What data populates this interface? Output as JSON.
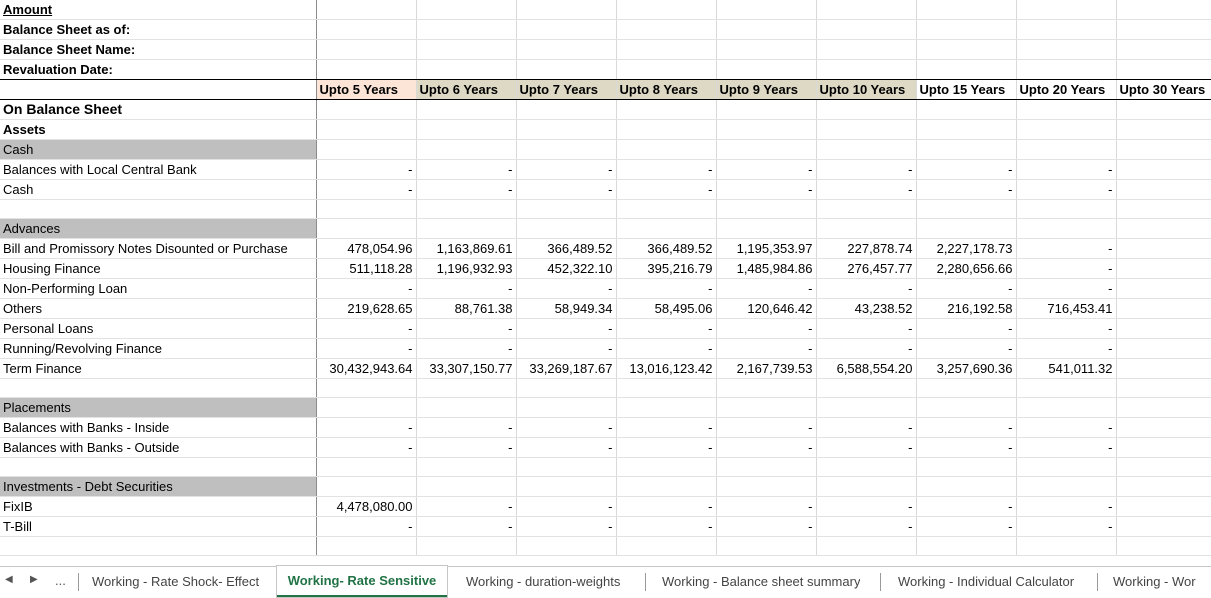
{
  "meta": {
    "amount": "Amount",
    "as_of": "Balance Sheet as of:",
    "name": "Balance Sheet Name:",
    "reval": "Revaluation Date:"
  },
  "columns": [
    "Upto 5 Years",
    "Upto 6 Years",
    "Upto 7 Years",
    "Upto 8 Years",
    "Upto 9 Years",
    "Upto 10 Years",
    "Upto 15 Years",
    "Upto 20 Years",
    "Upto 30 Years"
  ],
  "rows": [
    {
      "label": "On Balance Sheet",
      "style": "title",
      "values": []
    },
    {
      "label": "Assets",
      "style": "bold",
      "values": []
    },
    {
      "label": "Cash",
      "style": "section",
      "values": []
    },
    {
      "label": "Balances with Local Central Bank",
      "style": "",
      "values": [
        "-",
        "-",
        "-",
        "-",
        "-",
        "-",
        "-",
        "-",
        ""
      ]
    },
    {
      "label": "Cash",
      "style": "",
      "values": [
        "-",
        "-",
        "-",
        "-",
        "-",
        "-",
        "-",
        "-",
        ""
      ]
    },
    {
      "label": "",
      "style": "",
      "values": []
    },
    {
      "label": "Advances",
      "style": "section",
      "values": []
    },
    {
      "label": "Bill and Promissory Notes Disounted or Purchase",
      "style": "",
      "values": [
        "478,054.96",
        "1,163,869.61",
        "366,489.52",
        "366,489.52",
        "1,195,353.97",
        "227,878.74",
        "2,227,178.73",
        "-",
        ""
      ]
    },
    {
      "label": "Housing Finance",
      "style": "",
      "values": [
        "511,118.28",
        "1,196,932.93",
        "452,322.10",
        "395,216.79",
        "1,485,984.86",
        "276,457.77",
        "2,280,656.66",
        "-",
        ""
      ]
    },
    {
      "label": "Non-Performing Loan",
      "style": "",
      "values": [
        "-",
        "-",
        "-",
        "-",
        "-",
        "-",
        "-",
        "-",
        ""
      ]
    },
    {
      "label": "Others",
      "style": "",
      "values": [
        "219,628.65",
        "88,761.38",
        "58,949.34",
        "58,495.06",
        "120,646.42",
        "43,238.52",
        "216,192.58",
        "716,453.41",
        ""
      ]
    },
    {
      "label": "Personal Loans",
      "style": "",
      "values": [
        "-",
        "-",
        "-",
        "-",
        "-",
        "-",
        "-",
        "-",
        ""
      ]
    },
    {
      "label": "Running/Revolving Finance",
      "style": "",
      "values": [
        "-",
        "-",
        "-",
        "-",
        "-",
        "-",
        "-",
        "-",
        ""
      ]
    },
    {
      "label": "Term Finance",
      "style": "",
      "values": [
        "30,432,943.64",
        "33,307,150.77",
        "33,269,187.67",
        "13,016,123.42",
        "2,167,739.53",
        "6,588,554.20",
        "3,257,690.36",
        "541,011.32",
        ""
      ]
    },
    {
      "label": "",
      "style": "",
      "values": []
    },
    {
      "label": "Placements",
      "style": "section",
      "values": []
    },
    {
      "label": "Balances with Banks - Inside",
      "style": "",
      "values": [
        "-",
        "-",
        "-",
        "-",
        "-",
        "-",
        "-",
        "-",
        ""
      ]
    },
    {
      "label": "Balances with Banks - Outside",
      "style": "",
      "values": [
        "-",
        "-",
        "-",
        "-",
        "-",
        "-",
        "-",
        "-",
        ""
      ]
    },
    {
      "label": "",
      "style": "",
      "values": []
    },
    {
      "label": "Investments - Debt Securities",
      "style": "section",
      "values": []
    },
    {
      "label": "FixIB",
      "style": "",
      "values": [
        "4,478,080.00",
        "-",
        "-",
        "-",
        "-",
        "-",
        "-",
        "-",
        ""
      ]
    },
    {
      "label": "T-Bill",
      "style": "",
      "values": [
        "-",
        "-",
        "-",
        "-",
        "-",
        "-",
        "-",
        "-",
        ""
      ]
    },
    {
      "label": "",
      "style": "",
      "values": []
    }
  ],
  "tabs": {
    "nav_prev": "◀",
    "nav_next": "▶",
    "more": "...",
    "items": [
      {
        "label": "Working - Rate Shock- Effect",
        "active": false
      },
      {
        "label": "Working- Rate Sensitive",
        "active": true
      },
      {
        "label": "Working - duration-weights",
        "active": false
      },
      {
        "label": "Working - Balance sheet summary",
        "active": false
      },
      {
        "label": "Working - Individual Calculator",
        "active": false
      },
      {
        "label": "Working - Wor",
        "active": false
      }
    ]
  }
}
